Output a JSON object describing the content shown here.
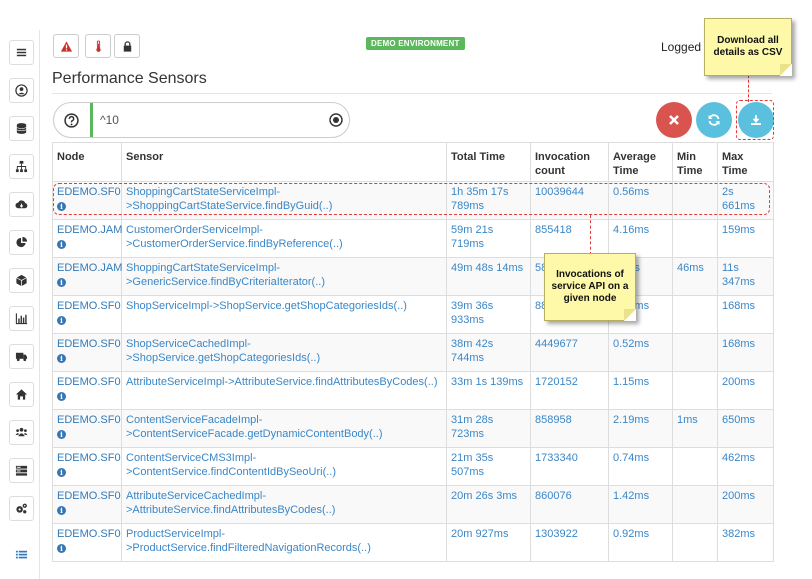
{
  "header": {
    "environment_badge": "DEMO ENVIRONMENT",
    "logged_text": "Logged i",
    "page_title": "Performance Sensors"
  },
  "filter": {
    "value": "^10"
  },
  "table": {
    "columns": [
      "Node",
      "Sensor",
      "Total Time",
      "Invocation count",
      "Average Time",
      "Min Time",
      "Max Time"
    ],
    "rows": [
      {
        "node": "EDEMO.SF0",
        "sensor": "ShoppingCartStateServiceImpl->ShoppingCartStateService.findByGuid(..)",
        "total": "1h 35m 17s 789ms",
        "count": "10039644",
        "avg": "0.56ms",
        "min": "",
        "max": "2s 661ms"
      },
      {
        "node": "EDEMO.JAM",
        "sensor": "CustomerOrderServiceImpl->CustomerOrderService.findByReference(..)",
        "total": "59m 21s 719ms",
        "count": "855418",
        "avg": "4.16ms",
        "min": "",
        "max": "159ms"
      },
      {
        "node": "EDEMO.JAM",
        "sensor": "ShoppingCartStateServiceImpl->GenericService.findByCriteriaIterator(..)",
        "total": "49m 48s 14ms",
        "count": "58",
        "avg": "04ms",
        "min": "46ms",
        "max": "11s 347ms"
      },
      {
        "node": "EDEMO.SF0",
        "sensor": "ShopServiceImpl->ShopService.getShopCategoriesIds(..)",
        "total": "39m 36s 933ms",
        "count": "88",
        "avg": "0.26ms",
        "min": "",
        "max": "168ms"
      },
      {
        "node": "EDEMO.SF0",
        "sensor": "ShopServiceCachedImpl->ShopService.getShopCategoriesIds(..)",
        "total": "38m 42s 744ms",
        "count": "4449677",
        "avg": "0.52ms",
        "min": "",
        "max": "168ms"
      },
      {
        "node": "EDEMO.SF0",
        "sensor": "AttributeServiceImpl->AttributeService.findAttributesByCodes(..)",
        "total": "33m 1s 139ms",
        "count": "1720152",
        "avg": "1.15ms",
        "min": "",
        "max": "200ms"
      },
      {
        "node": "EDEMO.SF0",
        "sensor": "ContentServiceFacadeImpl->ContentServiceFacade.getDynamicContentBody(..)",
        "total": "31m 28s 723ms",
        "count": "858958",
        "avg": "2.19ms",
        "min": "1ms",
        "max": "650ms"
      },
      {
        "node": "EDEMO.SF0",
        "sensor": "ContentServiceCMS3Impl->ContentService.findContentIdBySeoUri(..)",
        "total": "21m 35s 507ms",
        "count": "1733340",
        "avg": "0.74ms",
        "min": "",
        "max": "462ms"
      },
      {
        "node": "EDEMO.SF0",
        "sensor": "AttributeServiceCachedImpl->AttributeService.findAttributesByCodes(..)",
        "total": "20m 26s 3ms",
        "count": "860076",
        "avg": "1.42ms",
        "min": "",
        "max": "200ms"
      },
      {
        "node": "EDEMO.SF0",
        "sensor": "ProductServiceImpl->ProductService.findFilteredNavigationRecords(..)",
        "total": "20m 927ms",
        "count": "1303922",
        "avg": "0.92ms",
        "min": "",
        "max": "382ms"
      }
    ]
  },
  "callouts": {
    "download": "Download all details as CSV",
    "invocations": "Invocations of service API on a given node"
  },
  "colors": {
    "accent_blue": "#5bc0de",
    "danger_red": "#d9534f",
    "success_green": "#5cb85c",
    "link_blue": "#337ab7"
  },
  "icons": {
    "sidebar": [
      "menu-icon",
      "user-icon",
      "database-icon",
      "sitemap-icon",
      "cloud-download-icon",
      "pie-chart-icon",
      "cube-icon",
      "bar-chart-icon",
      "truck-icon",
      "home-icon",
      "users-icon",
      "server-icon",
      "cogs-icon",
      "list-icon"
    ],
    "topbar": [
      "warning-icon",
      "thermometer-icon",
      "lock-icon"
    ]
  }
}
